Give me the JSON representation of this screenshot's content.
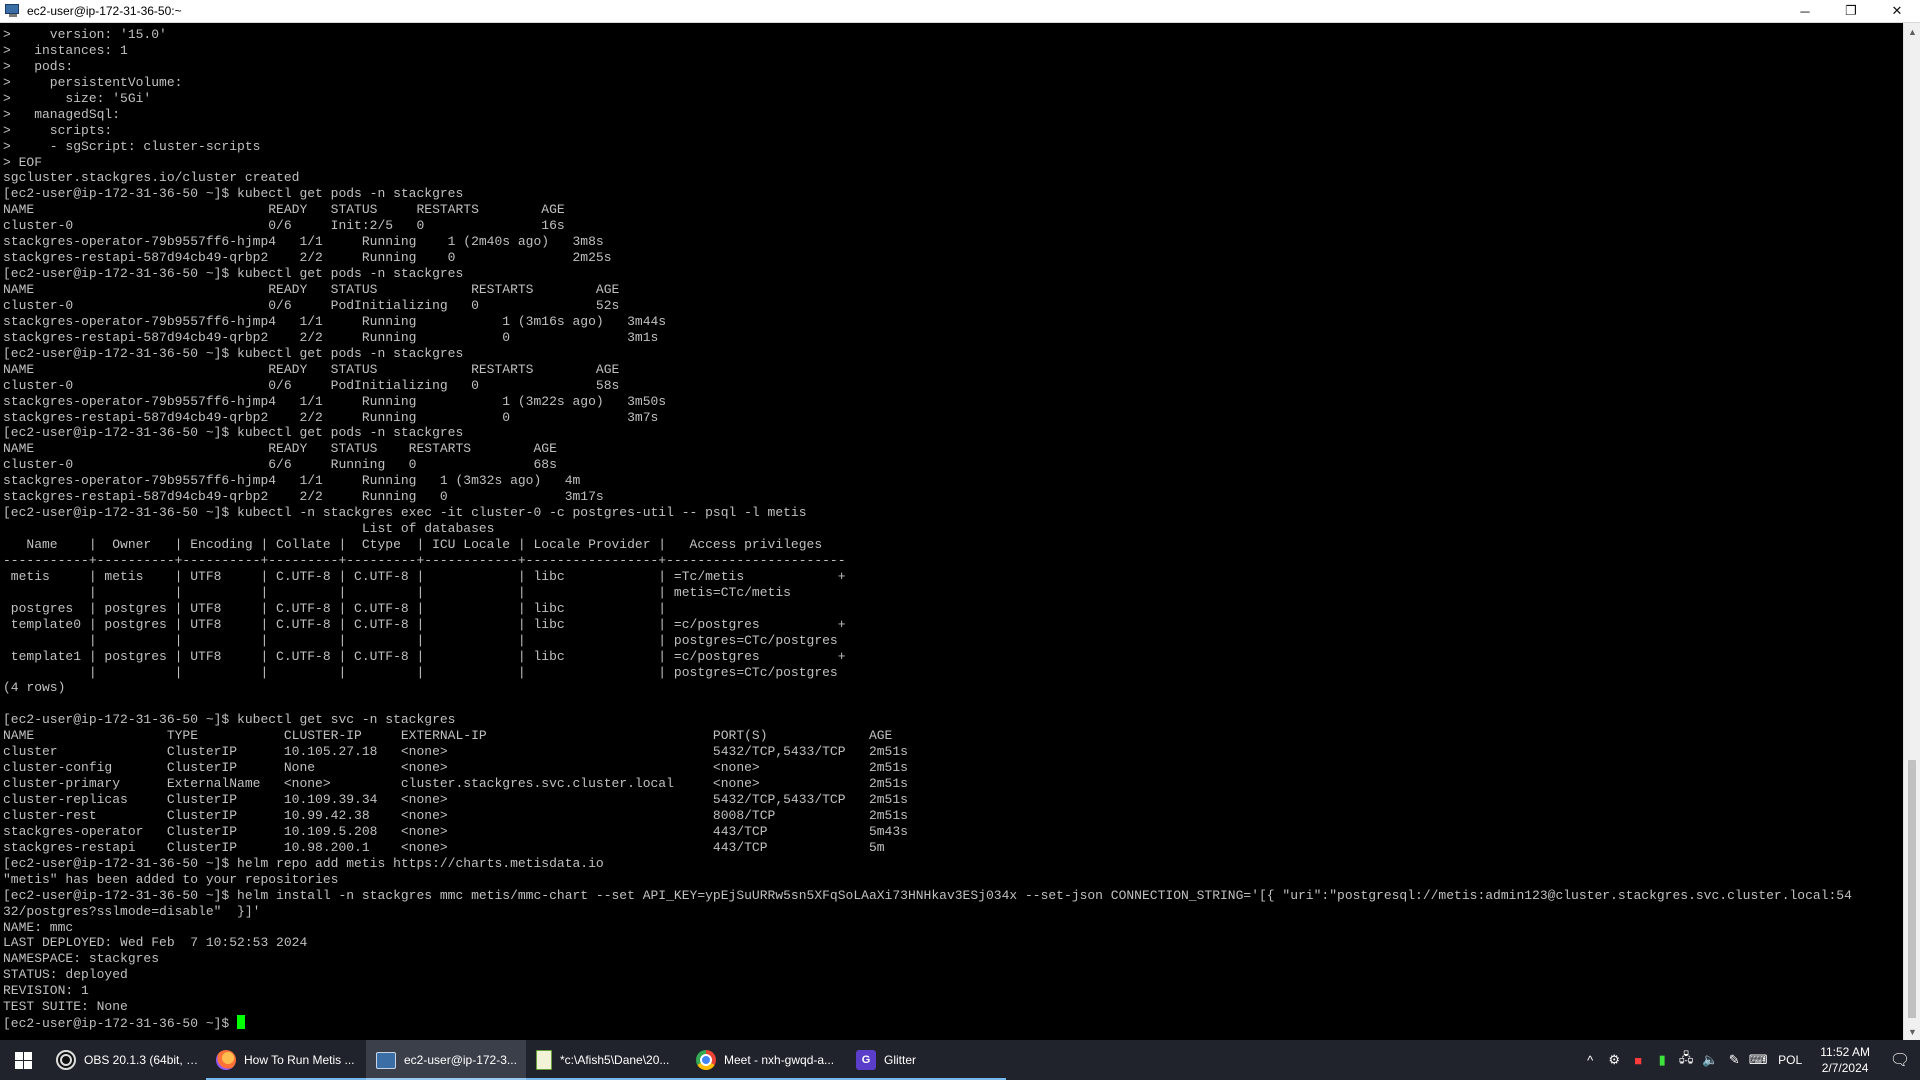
{
  "window": {
    "title": "ec2-user@ip-172-31-36-50:~",
    "minimize": "─",
    "maximize": "❐",
    "close": "✕"
  },
  "terminal": {
    "lines": [
      ">     version: '15.0'",
      ">   instances: 1",
      ">   pods:",
      ">     persistentVolume:",
      ">       size: '5Gi'",
      ">   managedSql:",
      ">     scripts:",
      ">     - sgScript: cluster-scripts",
      "> EOF",
      "sgcluster.stackgres.io/cluster created",
      "[ec2-user@ip-172-31-36-50 ~]$ kubectl get pods -n stackgres",
      "NAME                              READY   STATUS     RESTARTS        AGE",
      "cluster-0                         0/6     Init:2/5   0               16s",
      "stackgres-operator-79b9557ff6-hjmp4   1/1     Running    1 (2m40s ago)   3m8s",
      "stackgres-restapi-587d94cb49-qrbp2    2/2     Running    0               2m25s",
      "[ec2-user@ip-172-31-36-50 ~]$ kubectl get pods -n stackgres",
      "NAME                              READY   STATUS            RESTARTS        AGE",
      "cluster-0                         0/6     PodInitializing   0               52s",
      "stackgres-operator-79b9557ff6-hjmp4   1/1     Running           1 (3m16s ago)   3m44s",
      "stackgres-restapi-587d94cb49-qrbp2    2/2     Running           0               3m1s",
      "[ec2-user@ip-172-31-36-50 ~]$ kubectl get pods -n stackgres",
      "NAME                              READY   STATUS            RESTARTS        AGE",
      "cluster-0                         0/6     PodInitializing   0               58s",
      "stackgres-operator-79b9557ff6-hjmp4   1/1     Running           1 (3m22s ago)   3m50s",
      "stackgres-restapi-587d94cb49-qrbp2    2/2     Running           0               3m7s",
      "[ec2-user@ip-172-31-36-50 ~]$ kubectl get pods -n stackgres",
      "NAME                              READY   STATUS    RESTARTS        AGE",
      "cluster-0                         6/6     Running   0               68s",
      "stackgres-operator-79b9557ff6-hjmp4   1/1     Running   1 (3m32s ago)   4m",
      "stackgres-restapi-587d94cb49-qrbp2    2/2     Running   0               3m17s",
      "[ec2-user@ip-172-31-36-50 ~]$ kubectl -n stackgres exec -it cluster-0 -c postgres-util -- psql -l metis",
      "                                              List of databases",
      "   Name    |  Owner   | Encoding | Collate |  Ctype  | ICU Locale | Locale Provider |   Access privileges",
      "-----------+----------+----------+---------+---------+------------+-----------------+-----------------------",
      " metis     | metis    | UTF8     | C.UTF-8 | C.UTF-8 |            | libc            | =Tc/metis            +",
      "           |          |          |         |         |            |                 | metis=CTc/metis",
      " postgres  | postgres | UTF8     | C.UTF-8 | C.UTF-8 |            | libc            |",
      " template0 | postgres | UTF8     | C.UTF-8 | C.UTF-8 |            | libc            | =c/postgres          +",
      "           |          |          |         |         |            |                 | postgres=CTc/postgres",
      " template1 | postgres | UTF8     | C.UTF-8 | C.UTF-8 |            | libc            | =c/postgres          +",
      "           |          |          |         |         |            |                 | postgres=CTc/postgres",
      "(4 rows)",
      "",
      "[ec2-user@ip-172-31-36-50 ~]$ kubectl get svc -n stackgres",
      "NAME                 TYPE           CLUSTER-IP     EXTERNAL-IP                             PORT(S)             AGE",
      "cluster              ClusterIP      10.105.27.18   <none>                                  5432/TCP,5433/TCP   2m51s",
      "cluster-config       ClusterIP      None           <none>                                  <none>              2m51s",
      "cluster-primary      ExternalName   <none>         cluster.stackgres.svc.cluster.local     <none>              2m51s",
      "cluster-replicas     ClusterIP      10.109.39.34   <none>                                  5432/TCP,5433/TCP   2m51s",
      "cluster-rest         ClusterIP      10.99.42.38    <none>                                  8008/TCP            2m51s",
      "stackgres-operator   ClusterIP      10.109.5.208   <none>                                  443/TCP             5m43s",
      "stackgres-restapi    ClusterIP      10.98.200.1    <none>                                  443/TCP             5m",
      "[ec2-user@ip-172-31-36-50 ~]$ helm repo add metis https://charts.metisdata.io",
      "\"metis\" has been added to your repositories",
      "[ec2-user@ip-172-31-36-50 ~]$ helm install -n stackgres mmc metis/mmc-chart --set API_KEY=ypEjSuURRw5sn5XFqSoLAaXi73HNHkav3ESj034x --set-json CONNECTION_STRING='[{ \"uri\":\"postgresql://metis:admin123@cluster.stackgres.svc.cluster.local:54",
      "32/postgres?sslmode=disable\"  }]'",
      "NAME: mmc",
      "LAST DEPLOYED: Wed Feb  7 10:52:53 2024",
      "NAMESPACE: stackgres",
      "STATUS: deployed",
      "REVISION: 1",
      "TEST SUITE: None"
    ],
    "prompt": "[ec2-user@ip-172-31-36-50 ~]$ ",
    "text_color": "#c0c0c0",
    "cursor_color": "#00ff00"
  },
  "taskbar": {
    "items": [
      {
        "label": "OBS 20.1.3 (64bit, w...",
        "icon": "obs-icon",
        "active": false
      },
      {
        "label": "How To Run Metis ...",
        "icon": "firefox-icon",
        "active": false
      },
      {
        "label": "ec2-user@ip-172-3...",
        "icon": "terminal-icon",
        "active": true
      },
      {
        "label": "*c:\\Afish5\\Dane\\20...",
        "icon": "notepad-icon",
        "active": false
      },
      {
        "label": "Meet - nxh-gwqd-a...",
        "icon": "chrome-icon",
        "active": false
      },
      {
        "label": "Glitter",
        "icon": "glitter-icon",
        "active": false
      }
    ],
    "tray": {
      "chevron": "^",
      "language": "POL",
      "time": "11:52 AM",
      "date": "2/7/2024"
    }
  }
}
